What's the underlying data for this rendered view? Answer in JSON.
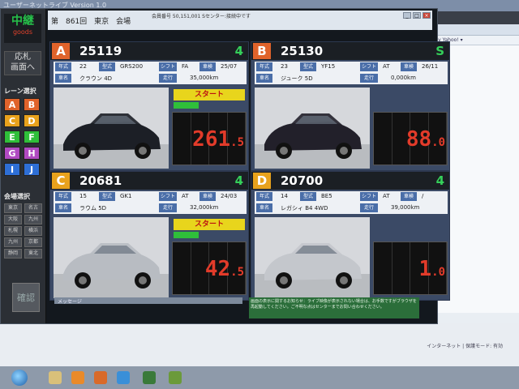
{
  "window": {
    "title": "ユーザーネットライブ  Version 1.0"
  },
  "browser": {
    "favorites": "My Yahoo! ▾",
    "tray_text": "インターネット | 保護モード: 有効"
  },
  "header": {
    "session": "第　861回　東京　会場",
    "member_info": "会員番号 50,151,001 Sセンター:接続中です"
  },
  "sidebar": {
    "logo_main": "中継",
    "logo_sub": "goods",
    "bid_button": "応札\n画面へ",
    "lane_select_label": "レーン選択",
    "lanes": [
      {
        "id": "A",
        "color": "#e0632b"
      },
      {
        "id": "B",
        "color": "#e0632b"
      },
      {
        "id": "C",
        "color": "#e8a21c"
      },
      {
        "id": "D",
        "color": "#e8a21c"
      },
      {
        "id": "E",
        "color": "#2fbf3a"
      },
      {
        "id": "F",
        "color": "#2fbf3a"
      },
      {
        "id": "G",
        "color": "#b04ac2"
      },
      {
        "id": "H",
        "color": "#b04ac2"
      },
      {
        "id": "I",
        "color": "#2e6fd6"
      },
      {
        "id": "J",
        "color": "#2e6fd6"
      }
    ],
    "venue_select_label": "会場選択",
    "venues": [
      "東京",
      "名古",
      "大阪",
      "九州",
      "札幌",
      "横浜",
      "九州",
      "京都",
      "静岡",
      "東北"
    ],
    "confirm_button": "確認"
  },
  "panels": [
    {
      "letter": "A",
      "letter_color": "#e0632b",
      "lot": "25119",
      "count": "4",
      "year": "22",
      "model": "GRS200",
      "shift": "FA",
      "car_inspection": "25/07",
      "name": "クラウン 4D",
      "mileage": "35,000km",
      "start_label": "スタート",
      "show_start": true,
      "progress": 0.35,
      "price_main": "261",
      "price_decimal": ".5",
      "car_color": "#1c1f26"
    },
    {
      "letter": "B",
      "letter_color": "#e0632b",
      "lot": "25130",
      "count": "S",
      "year": "23",
      "model": "YF15",
      "shift": "AT",
      "car_inspection": "26/11",
      "name": "ジューク 5D",
      "mileage": "0,000km",
      "start_label": "",
      "show_start": false,
      "progress": 0,
      "price_main": "88",
      "price_decimal": ".0",
      "car_color": "#22202a"
    },
    {
      "letter": "C",
      "letter_color": "#e8a21c",
      "lot": "20681",
      "count": "4",
      "year": "15",
      "model": "GK1",
      "shift": "AT",
      "car_inspection": "24/03",
      "name": "ラウム 5D",
      "mileage": "32,000km",
      "start_label": "スタート",
      "show_start": true,
      "progress": 0.35,
      "price_main": "42",
      "price_decimal": ".5",
      "car_color": "#b8bcc2"
    },
    {
      "letter": "D",
      "letter_color": "#e8a21c",
      "lot": "20700",
      "count": "4",
      "year": "14",
      "model": "BE5",
      "shift": "AT",
      "car_inspection": "/",
      "name": "レガシィ B4 4WD",
      "mileage": "39,000km",
      "start_label": "",
      "show_start": false,
      "progress": 0,
      "price_main": "1",
      "price_decimal": ".0",
      "car_color": "#c4c7cc"
    }
  ],
  "labels": {
    "year": "年式",
    "model": "型式",
    "shift": "シフト",
    "inspection": "車検",
    "name": "車名",
    "mileage": "走行"
  },
  "message_bar": "メッセージ",
  "notice": "画面の表示に関するお知らせ：ライブ映像が表示されない場合は、お手数ですがブラウザを再起動してください。ご不明な点はセンターまでお問い合わせください。"
}
